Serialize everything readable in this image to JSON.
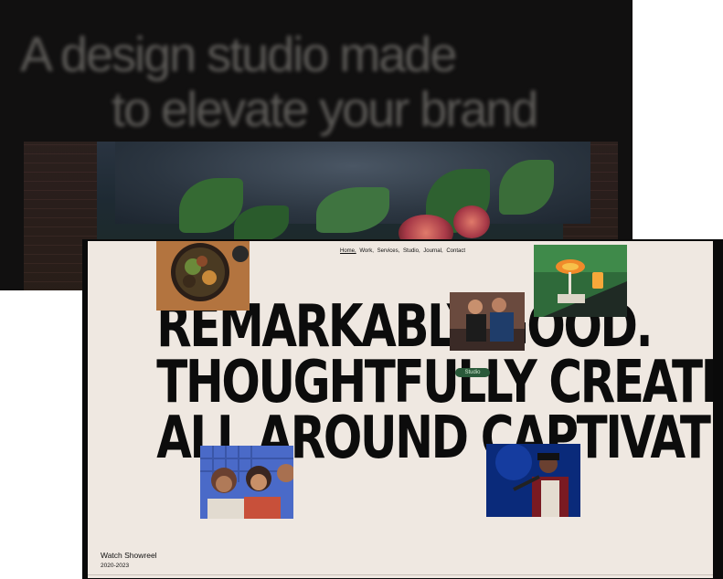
{
  "back_window": {
    "title_line1": "A design studio made",
    "title_line2": "to elevate your brand"
  },
  "front_window": {
    "nav": [
      {
        "label": "Home,",
        "active": true
      },
      {
        "label": "Work,",
        "active": false
      },
      {
        "label": "Services,",
        "active": false
      },
      {
        "label": "Studio,",
        "active": false
      },
      {
        "label": "Journal,",
        "active": false
      },
      {
        "label": "Contact",
        "active": false
      }
    ],
    "headline": [
      "REMARKABLY GOOD.",
      "THOUGHTFULLY CREATIVE.",
      "ALL AROUND CAPTIVATING."
    ],
    "cursor_badge": "Studio",
    "showreel_label": "Watch Showreel",
    "years": "2020-2023"
  },
  "colors": {
    "back_bg": "#111010",
    "front_bg": "#efe8e1",
    "headline": "#0c0c0c"
  },
  "photos": [
    "food-bowl",
    "cocktail",
    "couple",
    "friends-laughing",
    "singer-on-stage"
  ]
}
